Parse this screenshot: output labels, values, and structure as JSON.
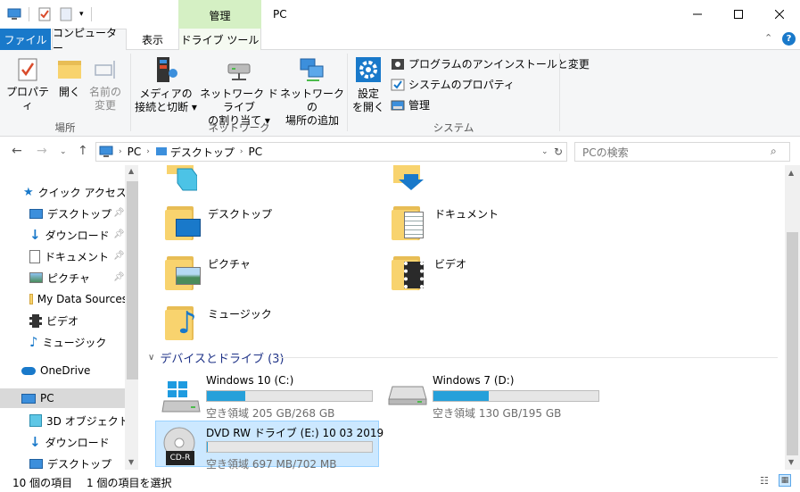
{
  "window": {
    "title": "PC",
    "context_tab": "管理"
  },
  "tabs": {
    "file": "ファイル",
    "computer": "コンピューター",
    "view": "表示",
    "drive_tools": "ドライブ ツール"
  },
  "ribbon": {
    "location": {
      "properties": "プロパティ",
      "open": "開く",
      "rename_1": "名前の",
      "rename_2": "変更",
      "group": "場所"
    },
    "network": {
      "media_1": "メディアの",
      "media_2": "接続と切断 ▾",
      "map_1": "ネットワーク ドライブ",
      "map_2": "の割り当て ▾",
      "add_1": "ネットワークの",
      "add_2": "場所の追加",
      "group": "ネットワーク"
    },
    "system": {
      "settings_1": "設定",
      "settings_2": "を開く",
      "uninstall": "プログラムのアンインストールと変更",
      "sysprops": "システムのプロパティ",
      "manage": "管理",
      "group": "システム"
    }
  },
  "address": {
    "crumbs": [
      "PC",
      "デスクトップ",
      "PC"
    ],
    "search_placeholder": "PCの検索"
  },
  "nav": {
    "quick_access": "クイック アクセス",
    "items": [
      {
        "label": "デスクトップ",
        "pinned": true
      },
      {
        "label": "ダウンロード",
        "pinned": true
      },
      {
        "label": "ドキュメント",
        "pinned": true
      },
      {
        "label": "ピクチャ",
        "pinned": true
      },
      {
        "label": "My Data Sources"
      },
      {
        "label": "ビデオ"
      },
      {
        "label": "ミュージック"
      }
    ],
    "onedrive": "OneDrive",
    "pc": "PC",
    "pc_items": [
      "3D オブジェクト",
      "ダウンロード",
      "デスクトップ"
    ]
  },
  "folders": [
    {
      "label": "デスクトップ"
    },
    {
      "label": "ドキュメント"
    },
    {
      "label": "ピクチャ"
    },
    {
      "label": "ビデオ"
    },
    {
      "label": "ミュージック"
    }
  ],
  "devices": {
    "header": "デバイスとドライブ (3)",
    "drives": [
      {
        "name": "Windows 10 (C:)",
        "free": "空き領域 205 GB/268 GB",
        "used_fraction": 0.235
      },
      {
        "name": "Windows 7 (D:)",
        "free": "空き領域 130 GB/195 GB",
        "used_fraction": 0.333
      },
      {
        "name": "DVD RW ドライブ (E:) 10 03 2019",
        "free": "空き領域 697 MB/702 MB",
        "used_fraction": 0.007,
        "badge": "CD-R"
      }
    ]
  },
  "status": {
    "items": "10 個の項目",
    "selected": "1 個の項目を選択"
  },
  "colors": {
    "accent": "#1979ca",
    "context": "#d5f0c4",
    "bar": "#26a0da",
    "selection": "#cce8ff"
  }
}
